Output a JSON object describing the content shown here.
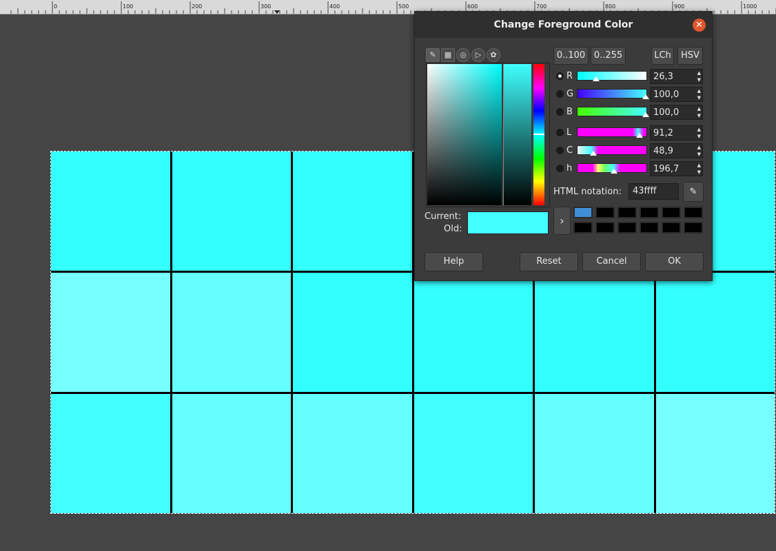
{
  "ruler": {
    "labels": [
      "0",
      "100",
      "200",
      "300",
      "400",
      "500",
      "600",
      "700",
      "800",
      "900",
      "1000"
    ]
  },
  "canvas": {
    "cells": [
      "#3ff",
      "#3ff",
      "#3ff",
      "#3ff",
      "#3ff",
      "#3ff",
      "#7ff",
      "#6ff",
      "#3ff",
      "#3ff",
      "#3ff",
      "#3ff",
      "#4ff",
      "#6ff",
      "#6ff",
      "#4ff",
      "#6ff",
      "#7ff"
    ]
  },
  "dialog": {
    "title": "Change Foreground Color",
    "close_icon": "close-icon",
    "picker_tools": [
      "gimp-icon",
      "cmyk-icon",
      "watercolor-icon",
      "wheel-icon",
      "palette-icon"
    ],
    "range_buttons": [
      "0..100",
      "0..255"
    ],
    "space_buttons": [
      "LCh",
      "HSV"
    ],
    "channels": [
      {
        "label": "R",
        "value": "26,3",
        "selected": true
      },
      {
        "label": "G",
        "value": "100,0",
        "selected": false
      },
      {
        "label": "B",
        "value": "100,0",
        "selected": false
      },
      {
        "label": "L",
        "value": "91,2",
        "selected": false
      },
      {
        "label": "C",
        "value": "48,9",
        "selected": false
      },
      {
        "label": "h",
        "value": "196,7",
        "selected": false
      }
    ],
    "html_label": "HTML notation:",
    "html_value": "43ffff",
    "eyedropper_icon": "eyedropper-icon",
    "current_label": "Current:",
    "old_label": "Old:",
    "current_color": "#43ffff",
    "history_first_color": "#3f8fd6",
    "buttons": {
      "help": "Help",
      "reset": "Reset",
      "cancel": "Cancel",
      "ok": "OK"
    }
  }
}
